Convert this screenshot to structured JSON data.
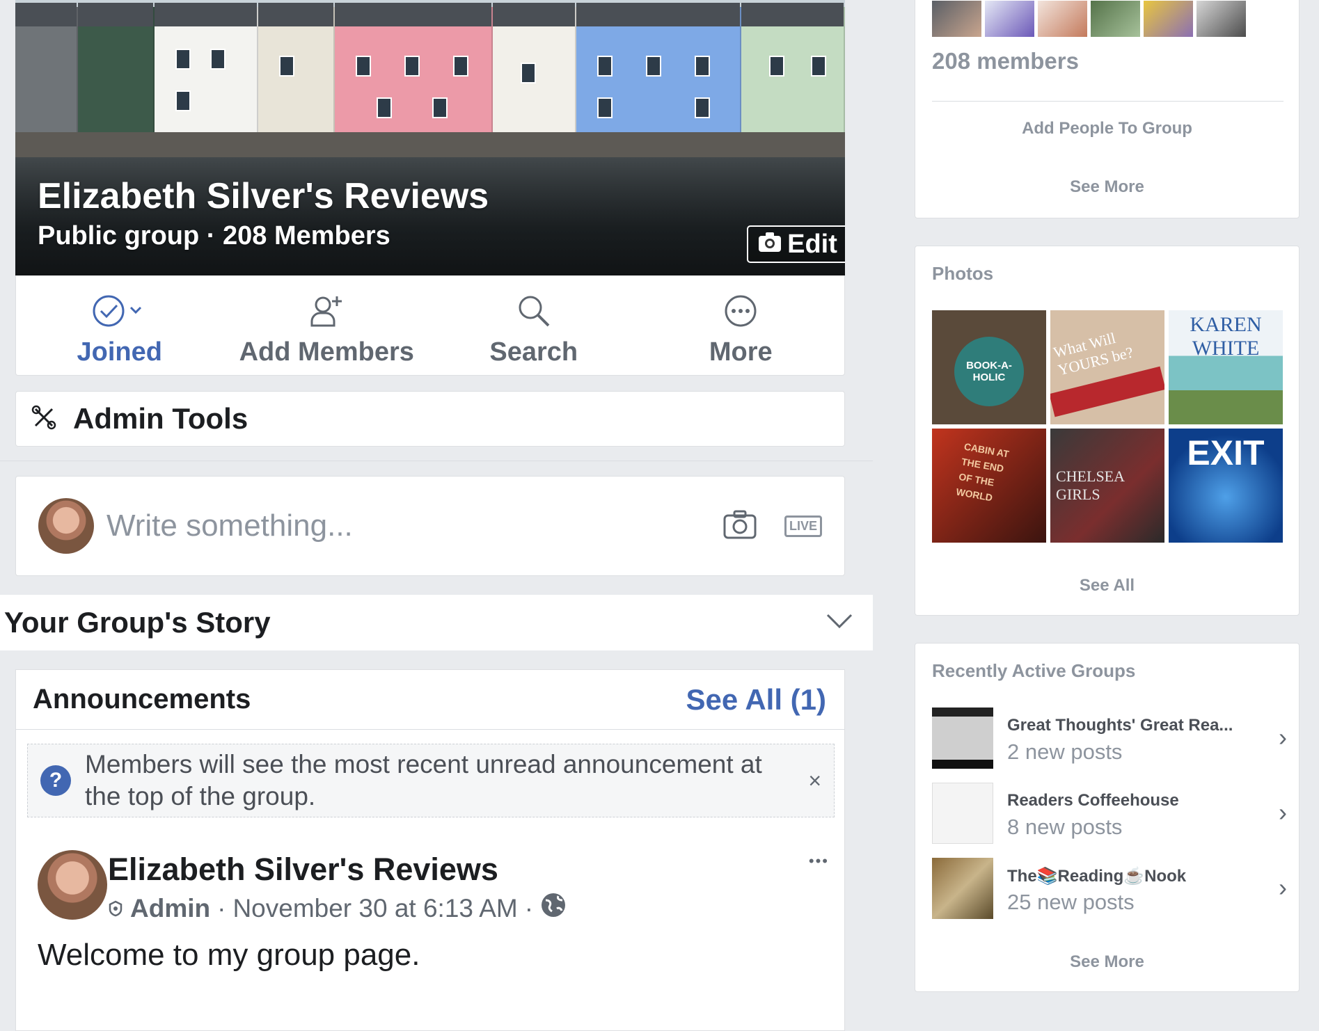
{
  "cover": {
    "title": "Elizabeth Silver's Reviews",
    "subtitle": "Public group · 208 Members",
    "edit_label": "Edit"
  },
  "actions": [
    {
      "label": "Joined",
      "icon": "check-circle-icon"
    },
    {
      "label": "Add Members",
      "icon": "add-person-icon"
    },
    {
      "label": "Search",
      "icon": "search-icon"
    },
    {
      "label": "More",
      "icon": "more-circle-icon"
    }
  ],
  "admin_tools": {
    "label": "Admin Tools",
    "icon": "tools-icon"
  },
  "composer": {
    "placeholder": "Write something...",
    "live_label": "LIVE"
  },
  "story": {
    "title": "Your Group's Story"
  },
  "announcements": {
    "title": "Announcements",
    "see_all": "See All (1)",
    "notice": "Members will see the most recent unread announcement at the top of the group.",
    "notice_close": "×"
  },
  "post": {
    "author": "Elizabeth Silver's Reviews",
    "role": "Admin",
    "timestamp": "November 30 at 6:13 AM",
    "separator": "·",
    "body": "Welcome to my group page.",
    "menu": "•••"
  },
  "sidebar": {
    "members": {
      "count": "208 members",
      "add_people": "Add People To Group",
      "see_more": "See More"
    },
    "photos": {
      "title": "Photos",
      "see_all": "See All",
      "tiles": [
        {
          "text": "BOOK-A-HOLIC"
        },
        {
          "text": "What Will YOURS be?"
        },
        {
          "text": "KAREN WHITE"
        },
        {
          "text": "CABIN AT THE END OF THE WORLD"
        },
        {
          "text": "CHELSEA GIRLS"
        },
        {
          "text": "EXIT"
        }
      ]
    },
    "recent_groups": {
      "title": "Recently Active Groups",
      "items": [
        {
          "name": "Great Thoughts' Great Rea...",
          "posts": "2 new posts"
        },
        {
          "name": "Readers Coffeehouse",
          "posts": "8 new posts"
        },
        {
          "name": "The📚Reading☕Nook",
          "posts": "25 new posts"
        }
      ],
      "see_more": "See More"
    }
  },
  "colors": {
    "accent": "#4267b2",
    "muted": "#8d949e",
    "background": "#e9ebee"
  }
}
